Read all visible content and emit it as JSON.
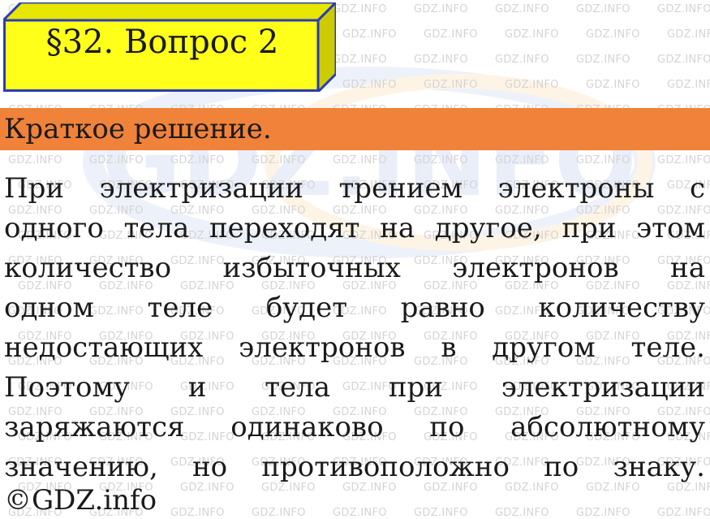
{
  "title": "§32. Вопрос 2",
  "banner": "Краткое решение.",
  "body_lines": [
    [
      "При",
      "электризации",
      "трением",
      "электроны",
      "с"
    ],
    [
      "одного",
      "тела",
      "переходят",
      "на",
      "другое,",
      "при",
      "этом"
    ],
    [
      "количество",
      "избыточных",
      "электронов",
      "на"
    ],
    [
      "одном",
      "теле",
      "будет",
      "равно",
      "количеству"
    ],
    [
      "недостающих",
      "электронов",
      "в",
      "другом",
      "теле."
    ],
    [
      "Поэтому",
      "и",
      "тела",
      "при",
      "электризации"
    ],
    [
      "заряжаются",
      "одинаково",
      "по",
      "абсолютному"
    ],
    [
      "значению,",
      "но",
      "противоположно",
      "по",
      "знаку."
    ]
  ],
  "copyright": "©GDZ.info",
  "watermark": {
    "text": "GDZ.INFO",
    "logo_text": "GDZ.INFO"
  },
  "colors": {
    "title_bg": "#ffff1a",
    "title_border": "#2b3cb8",
    "banner_bg": "#f0823a",
    "text": "#1a1a1a"
  }
}
